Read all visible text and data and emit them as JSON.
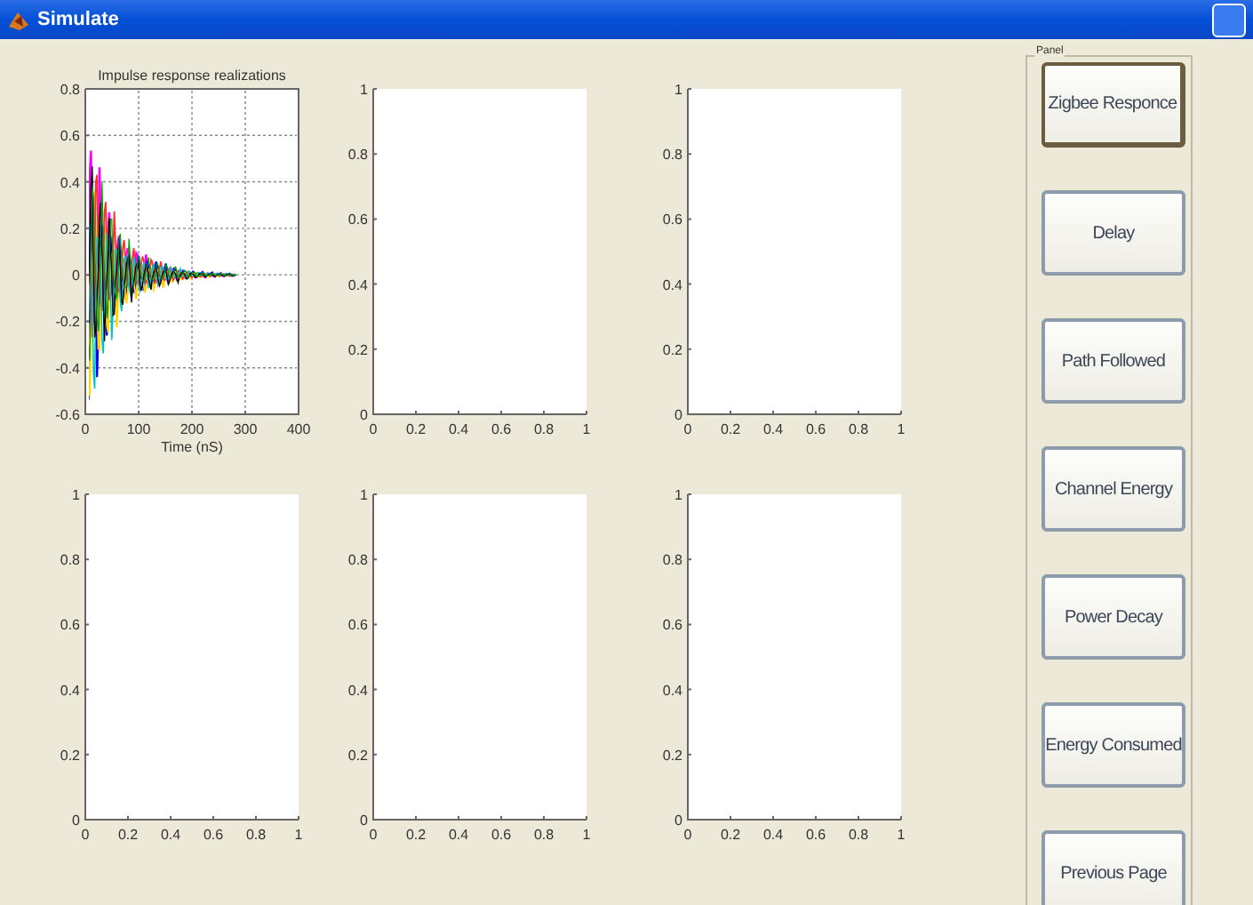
{
  "window": {
    "title": "Simulate"
  },
  "axes": [
    {
      "chart_data": {
        "type": "line",
        "title": "Impulse response realizations",
        "xlabel": "Time (nS)",
        "xlim": [
          0,
          400
        ],
        "ylim": [
          -0.6,
          0.8
        ],
        "xticks": [
          0,
          100,
          200,
          300,
          400
        ],
        "yticks": [
          -0.6,
          -0.4,
          -0.2,
          0,
          0.2,
          0.4,
          0.6,
          0.8
        ],
        "grid": true
      }
    },
    {
      "chart_data": {
        "type": "line",
        "xlim": [
          0,
          1
        ],
        "ylim": [
          0,
          1
        ],
        "xticks": [
          0,
          0.2,
          0.4,
          0.6,
          0.8,
          1
        ],
        "yticks": [
          0,
          0.2,
          0.4,
          0.6,
          0.8,
          1
        ]
      }
    },
    {
      "chart_data": {
        "type": "line",
        "xlim": [
          0,
          1
        ],
        "ylim": [
          0,
          1
        ],
        "xticks": [
          0,
          0.2,
          0.4,
          0.6,
          0.8,
          1
        ],
        "yticks": [
          0,
          0.2,
          0.4,
          0.6,
          0.8,
          1
        ]
      }
    },
    {
      "chart_data": {
        "type": "line",
        "xlim": [
          0,
          1
        ],
        "ylim": [
          0,
          1
        ],
        "xticks": [
          0,
          0.2,
          0.4,
          0.6,
          0.8,
          1
        ],
        "yticks": [
          0,
          0.2,
          0.4,
          0.6,
          0.8,
          1
        ]
      }
    },
    {
      "chart_data": {
        "type": "line",
        "xlim": [
          0,
          1
        ],
        "ylim": [
          0,
          1
        ],
        "xticks": [
          0,
          0.2,
          0.4,
          0.6,
          0.8,
          1
        ],
        "yticks": [
          0,
          0.2,
          0.4,
          0.6,
          0.8,
          1
        ]
      }
    },
    {
      "chart_data": {
        "type": "line",
        "xlim": [
          0,
          1
        ],
        "ylim": [
          0,
          1
        ],
        "xticks": [
          0,
          0.2,
          0.4,
          0.6,
          0.8,
          1
        ],
        "yticks": [
          0,
          0.2,
          0.4,
          0.6,
          0.8,
          1
        ]
      }
    }
  ],
  "panel": {
    "label": "Panel",
    "buttons": [
      {
        "label": "Zigbee Responce",
        "focused": true
      },
      {
        "label": "Delay",
        "focused": false
      },
      {
        "label": "Path Followed",
        "focused": false
      },
      {
        "label": "Channel Energy",
        "focused": false
      },
      {
        "label": "Power Decay",
        "focused": false
      },
      {
        "label": "Energy Consumed",
        "focused": false
      },
      {
        "label": "Previous Page",
        "focused": false
      }
    ]
  }
}
